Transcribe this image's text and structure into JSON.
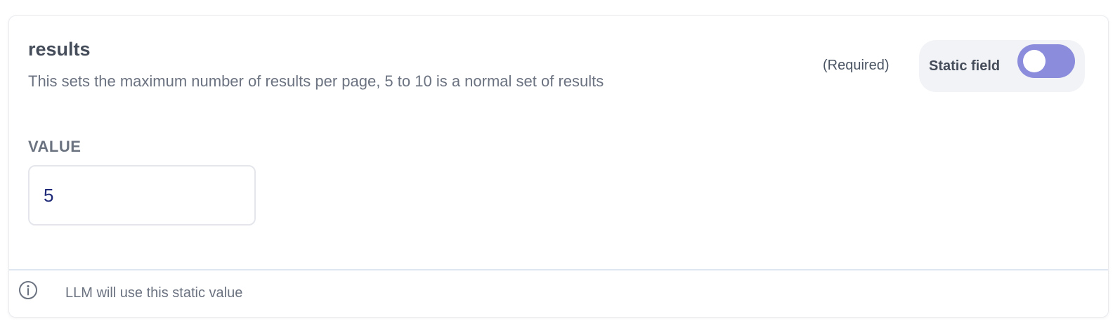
{
  "field": {
    "name": "results",
    "description": "This sets the maximum number of results per page, 5 to 10 is a normal set of results",
    "required_label": "(Required)"
  },
  "static_toggle": {
    "label": "Static field",
    "state": "on",
    "color": "#8b8cdc"
  },
  "value": {
    "label": "VALUE",
    "current": "5",
    "placeholder": ""
  },
  "footer": {
    "icon": "info-icon",
    "message": "LLM will use this static value"
  }
}
